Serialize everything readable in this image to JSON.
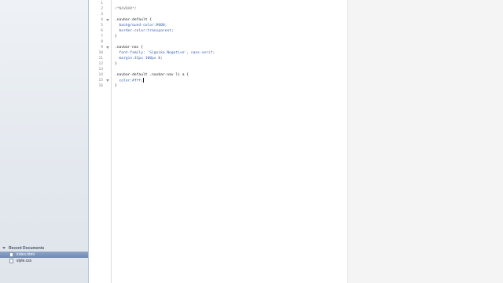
{
  "sidebar": {
    "recent_documents_header": "Recent Documents",
    "documents": [
      {
        "name": "index.html",
        "selected": true
      },
      {
        "name": "style.css",
        "selected": false
      }
    ]
  },
  "editor": {
    "line_numbers": [
      "1",
      "2",
      "3",
      "4",
      "5",
      "6",
      "7",
      "8",
      "9",
      "10",
      "11",
      "12",
      "13",
      "14",
      "15",
      "16"
    ],
    "lines": [
      "",
      "/*NAVBAR*/",
      "",
      ".navbar-default {",
      "  background-color:#000;",
      "  border-color:transparent;",
      "}",
      "",
      ".navbar-nav {",
      "  font-family: 'Signika Negative', sans-serif;",
      "  margin:31px 100px 0;",
      "}",
      "",
      ".navbar-default .navbar-nav li a {",
      "  color:#fff;",
      "}"
    ],
    "current_line": 15
  },
  "colors": {
    "sidebar_bg": "#e3e8ee",
    "selection": "#7f97bd",
    "current_line_highlight": "#fbfbd8",
    "property": "#3a5ea7"
  }
}
